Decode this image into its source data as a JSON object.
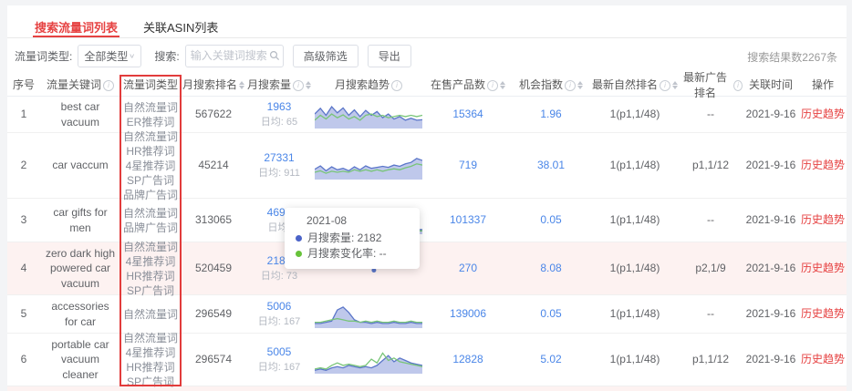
{
  "tabs": [
    {
      "label": "搜索流量词列表",
      "active": true
    },
    {
      "label": "关联ASIN列表",
      "active": false
    }
  ],
  "filters": {
    "type_label": "流量词类型:",
    "type_value": "全部类型",
    "search_label": "搜索:",
    "search_placeholder": "输入关键词搜索",
    "advanced_button": "高级筛选",
    "export_button": "导出",
    "result_count": "搜索结果数2267条"
  },
  "colors": {
    "accent_red": "#e64242",
    "link_blue": "#4a86e8",
    "spark_blue": "#5b76c9",
    "spark_fill": "#a9b6e4",
    "spark_green": "#78c578",
    "row_highlight": "#fdf2f1",
    "tooltip_blue_dot": "#4b63c8",
    "tooltip_green_dot": "#67c23a"
  },
  "table": {
    "headers": [
      {
        "label": "序号",
        "info": false,
        "sort": false
      },
      {
        "label": "流量关键词",
        "info": true,
        "sort": false
      },
      {
        "label": "流量词类型",
        "info": false,
        "sort": false,
        "highlighted": true
      },
      {
        "label": "月搜索排名",
        "info": false,
        "sort": true
      },
      {
        "label": "月搜索量",
        "info": true,
        "sort": true
      },
      {
        "label": "月搜索趋势",
        "info": true,
        "sort": false
      },
      {
        "label": "在售产品数",
        "info": true,
        "sort": true
      },
      {
        "label": "机会指数",
        "info": true,
        "sort": true
      },
      {
        "label": "最新自然排名",
        "info": true,
        "sort": true
      },
      {
        "label": "最新广告排名",
        "info": true,
        "sort": false
      },
      {
        "label": "关联时间",
        "info": false,
        "sort": false
      },
      {
        "label": "操作",
        "info": false,
        "sort": false
      }
    ],
    "rows": [
      {
        "index": "1",
        "keyword": "best car vacuum",
        "types": [
          "自然流量词",
          "ER推荐词"
        ],
        "month_rank": "567622",
        "month_volume": "1963",
        "daily_avg": "日均: 65",
        "products": "15364",
        "opportunity": "1.96",
        "organic_rank": "1(p1,1/48)",
        "ad_rank": "--",
        "linked_date": "2021-9-16",
        "action": "历史趋势",
        "trend": {
          "blue": [
            0.55,
            0.78,
            0.5,
            0.85,
            0.6,
            0.8,
            0.5,
            0.72,
            0.45,
            0.7,
            0.5,
            0.65,
            0.4,
            0.55,
            0.35,
            0.45,
            0.3,
            0.38,
            0.3,
            0.32
          ],
          "green": [
            0.3,
            0.5,
            0.35,
            0.55,
            0.4,
            0.52,
            0.35,
            0.45,
            0.3,
            0.5,
            0.55,
            0.45,
            0.5,
            0.4,
            0.45,
            0.5,
            0.45,
            0.5,
            0.45,
            0.5
          ]
        }
      },
      {
        "index": "2",
        "keyword": "car vaccum",
        "types": [
          "自然流量词",
          "HR推荐词",
          "4星推荐词",
          "SP广告词",
          "品牌广告词"
        ],
        "month_rank": "45214",
        "month_volume": "27331",
        "daily_avg": "日均: 911",
        "products": "719",
        "opportunity": "38.01",
        "organic_rank": "1(p1,1/48)",
        "ad_rank": "p1,1/12",
        "linked_date": "2021-9-16",
        "action": "历史趋势",
        "trend": {
          "blue": [
            0.38,
            0.52,
            0.32,
            0.48,
            0.36,
            0.42,
            0.32,
            0.48,
            0.36,
            0.52,
            0.42,
            0.46,
            0.5,
            0.46,
            0.55,
            0.5,
            0.6,
            0.66,
            0.82,
            0.74
          ],
          "green": [
            0.26,
            0.32,
            0.22,
            0.3,
            0.26,
            0.3,
            0.26,
            0.36,
            0.3,
            0.36,
            0.3,
            0.36,
            0.3,
            0.36,
            0.4,
            0.36,
            0.44,
            0.5,
            0.6,
            0.55
          ]
        }
      },
      {
        "index": "3",
        "keyword": "car gifts for men",
        "types": [
          "自然流量词",
          "品牌广告词"
        ],
        "month_rank": "313065",
        "month_volume": "4696",
        "daily_avg": "日均:",
        "products": "101337",
        "opportunity": "0.05",
        "organic_rank": "1(p1,1/48)",
        "ad_rank": "--",
        "linked_date": "2021-9-16",
        "action": "历史趋势",
        "trend": {
          "blue": [
            0.15,
            0.2,
            0.15,
            0.5,
            0.2,
            0.15,
            0.3,
            0.2,
            0.15,
            0.35,
            0.2,
            0.6,
            0.25,
            0.15,
            0.2,
            0.15,
            0.2,
            0.15,
            0.15,
            0.15
          ],
          "green": [
            0.1,
            0.15,
            0.1,
            0.7,
            0.15,
            0.1,
            0.42,
            0.15,
            0.1,
            0.46,
            0.15,
            0.85,
            0.3,
            0.1,
            0.15,
            0.1,
            0.2,
            0.1,
            0.1,
            0.1
          ]
        }
      },
      {
        "index": "4",
        "keyword": "zero dark high powered car vacuum",
        "types": [
          "自然流量词",
          "4星推荐词",
          "HR推荐词",
          "SP广告词"
        ],
        "month_rank": "520459",
        "month_volume": "2182",
        "daily_avg": "日均: 73",
        "products": "270",
        "opportunity": "8.08",
        "organic_rank": "1(p1,1/48)",
        "ad_rank": "p2,1/9",
        "linked_date": "2021-9-16",
        "action": "历史趋势",
        "highlighted": true,
        "trend": {
          "dot": true
        }
      },
      {
        "index": "5",
        "keyword": "accessories for car",
        "types": [
          "自然流量词"
        ],
        "month_rank": "296549",
        "month_volume": "5006",
        "daily_avg": "日均: 167",
        "products": "139006",
        "opportunity": "0.05",
        "organic_rank": "1(p1,1/48)",
        "ad_rank": "--",
        "linked_date": "2021-9-16",
        "action": "历史趋势",
        "trend": {
          "blue": [
            0.15,
            0.15,
            0.2,
            0.25,
            0.7,
            0.82,
            0.6,
            0.3,
            0.2,
            0.2,
            0.15,
            0.2,
            0.15,
            0.15,
            0.2,
            0.15,
            0.15,
            0.2,
            0.15,
            0.15
          ],
          "green": [
            0.2,
            0.2,
            0.25,
            0.3,
            0.35,
            0.3,
            0.25,
            0.25,
            0.2,
            0.25,
            0.2,
            0.25,
            0.2,
            0.2,
            0.25,
            0.2,
            0.2,
            0.25,
            0.2,
            0.2
          ]
        }
      },
      {
        "index": "6",
        "keyword": "portable car vacuum cleaner",
        "types": [
          "自然流量词",
          "4星推荐词",
          "HR推荐词",
          "SP广告词"
        ],
        "month_rank": "296574",
        "month_volume": "5005",
        "daily_avg": "日均: 167",
        "products": "12828",
        "opportunity": "5.02",
        "organic_rank": "1(p1,1/48)",
        "ad_rank": "p1,1/12",
        "linked_date": "2021-9-16",
        "action": "历史趋势",
        "trend": {
          "blue": [
            0.1,
            0.15,
            0.1,
            0.2,
            0.25,
            0.2,
            0.3,
            0.25,
            0.2,
            0.25,
            0.2,
            0.3,
            0.5,
            0.7,
            0.45,
            0.6,
            0.5,
            0.4,
            0.35,
            0.3
          ],
          "green": [
            0.15,
            0.2,
            0.15,
            0.3,
            0.4,
            0.3,
            0.35,
            0.3,
            0.25,
            0.3,
            0.55,
            0.4,
            0.8,
            0.5,
            0.6,
            0.45,
            0.4,
            0.35,
            0.3,
            0.25
          ]
        }
      }
    ]
  },
  "tooltip": {
    "title": "2021-08",
    "lines": [
      {
        "text": "月搜索量: 2182",
        "dot_color": "#4b63c8"
      },
      {
        "text": "月搜索变化率: --",
        "dot_color": "#67c23a"
      }
    ]
  },
  "chart_data": {
    "type": "line",
    "note": "sparkline series per table row under table.rows[].trend (blue = 月搜索量, green = 月搜索变化率), normalized 0-1"
  }
}
